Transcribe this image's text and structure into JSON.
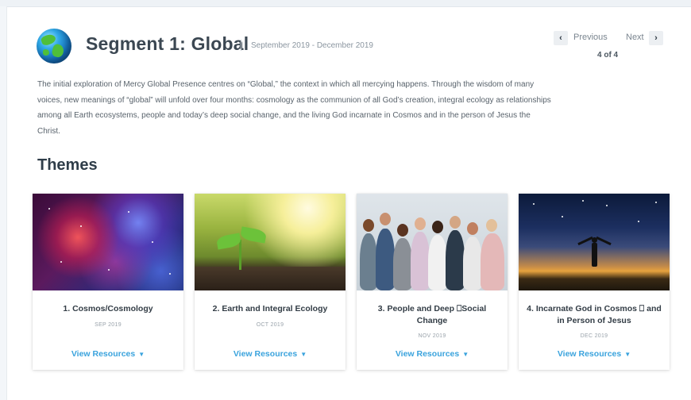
{
  "header": {
    "title": "Segment 1: Global",
    "date_range": "September 2019 - December 2019",
    "globe_icon": "globe-icon"
  },
  "pager": {
    "previous_label": "Previous",
    "next_label": "Next",
    "count": "4 of 4",
    "prev_icon": "chevron-left-icon",
    "next_icon": "chevron-right-icon",
    "prev_glyph": "‹",
    "next_glyph": "›"
  },
  "description": "The initial exploration of Mercy Global Presence centres on “Global,” the context in which all mercying happens. Through the wisdom of many voices, new meanings of “global” will unfold over four months: cosmology as the communion of all God’s creation, integral ecology as relationships among all Earth ecosystems, people and today’s deep social change, and the living God incarnate in Cosmos and in the person of Jesus the Christ.",
  "themes": {
    "heading": "Themes",
    "cards": [
      {
        "title": "1. Cosmos/Cosmology",
        "date": "SEP 2019",
        "link": "View Resources"
      },
      {
        "title": "2. Earth and Integral Ecology",
        "date": "OCT 2019",
        "link": "View Resources"
      },
      {
        "title": "3. People and Deep ⎕Social Change",
        "date": "NOV 2019",
        "link": "View Resources"
      },
      {
        "title": "4. Incarnate God in Cosmos ⎕ and in Person of Jesus",
        "date": "DEC 2019",
        "link": "View Resources"
      }
    ],
    "caret": "▼"
  },
  "colors": {
    "link": "#3aa3dd",
    "title": "#3b4752"
  }
}
